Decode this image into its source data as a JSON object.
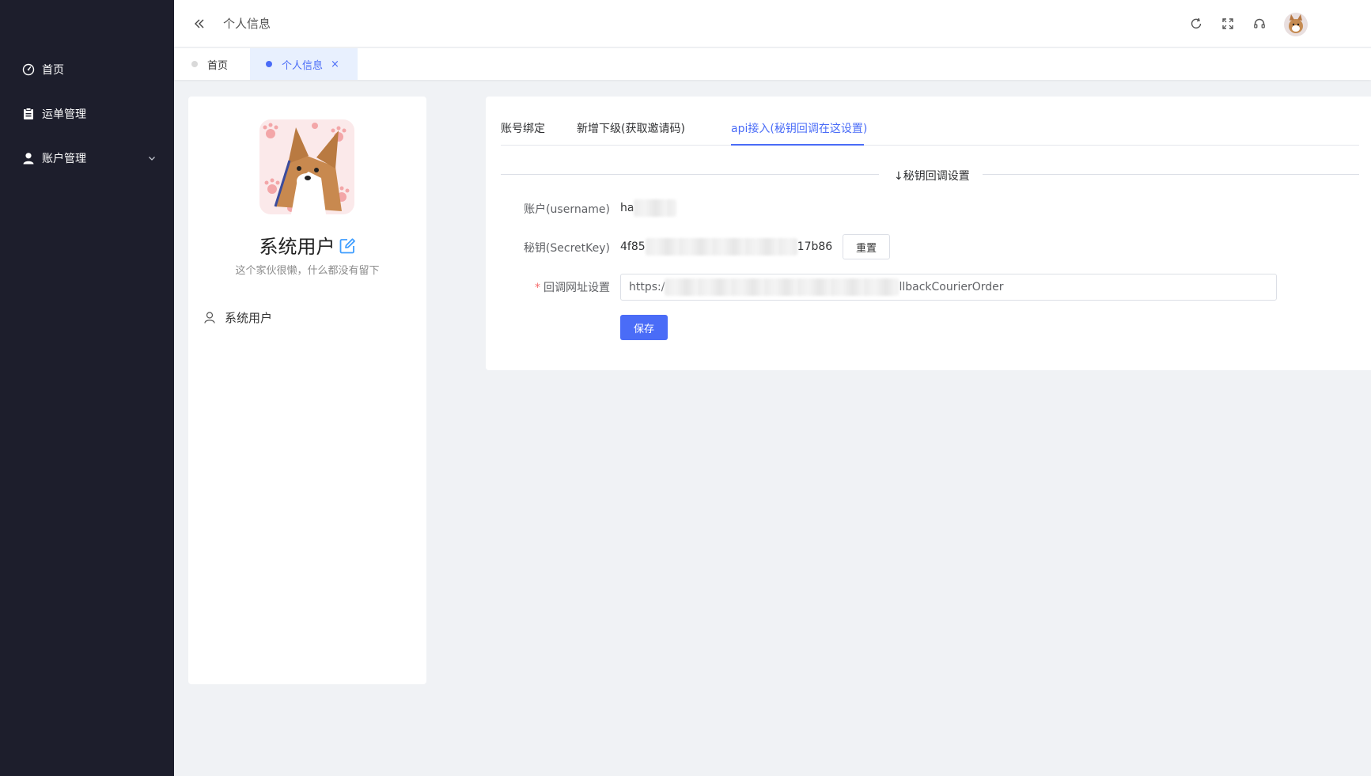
{
  "sidebar": {
    "items": [
      {
        "label": "首页",
        "icon": "dashboard-icon"
      },
      {
        "label": "运单管理",
        "icon": "clipboard-icon"
      },
      {
        "label": "账户管理",
        "icon": "user-icon"
      }
    ]
  },
  "header": {
    "breadcrumb": "个人信息",
    "icons": [
      "refresh-icon",
      "fullscreen-icon",
      "headset-icon"
    ]
  },
  "tags": {
    "home": "首页",
    "active": "个人信息",
    "close": "×"
  },
  "profile": {
    "name": "系统用户",
    "motto": "这个家伙很懒，什么都没有留下",
    "role": "系统用户"
  },
  "settings": {
    "tabs": [
      "账号绑定",
      "新增下级(获取邀请码)",
      "api接入(秘钥回调在这设置)"
    ],
    "active_tab": 2,
    "section_title": "↓秘钥回调设置",
    "form": {
      "username_label": "账户(username)",
      "username_prefix": "ha",
      "secret_label": "秘钥(SecretKey)",
      "secret_prefix": "4f85",
      "secret_suffix": "17b86",
      "reset_label": "重置",
      "callback_required": "*",
      "callback_label": "回调网址设置",
      "callback_prefix": "https:/",
      "callback_suffix": "llbackCourierOrder",
      "save_label": "保存"
    }
  },
  "colors": {
    "sidebar_bg": "#1d1e2c",
    "primary": "#4a6cf7",
    "page_bg": "#f0f2f5"
  }
}
